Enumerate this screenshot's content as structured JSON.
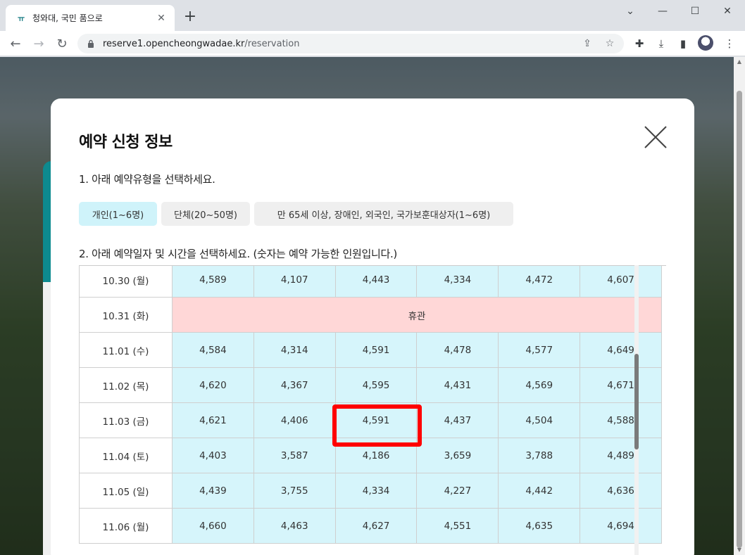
{
  "browser": {
    "tab_title": "청와대, 국민 품으로",
    "url_host": "reserve1.opencheongwadae.kr",
    "url_path": "/reservation",
    "favicon_text": "ㅠ"
  },
  "modal": {
    "title": "예약 신청 정보",
    "step1": "1. 아래 예약유형을 선택하세요.",
    "step2": "2. 아래 예약일자 및 시간을 선택하세요. (숫자는 예약 가능한 인원입니다.)",
    "types": [
      {
        "label": "개인(1~6명)",
        "selected": true
      },
      {
        "label": "단체(20~50명)",
        "selected": false
      },
      {
        "label": "만 65세 이상, 장애인, 외국인, 국가보훈대상자(1~6명)",
        "selected": false
      }
    ]
  },
  "schedule": {
    "closed_label": "휴관",
    "rows": [
      {
        "date": "10.30 (월)",
        "slots": [
          "4,589",
          "4,107",
          "4,443",
          "4,334",
          "4,472",
          "4,607"
        ]
      },
      {
        "date": "10.31 (화)",
        "closed": true
      },
      {
        "date": "11.01 (수)",
        "slots": [
          "4,584",
          "4,314",
          "4,591",
          "4,478",
          "4,577",
          "4,649"
        ]
      },
      {
        "date": "11.02 (목)",
        "slots": [
          "4,620",
          "4,367",
          "4,595",
          "4,431",
          "4,569",
          "4,671"
        ]
      },
      {
        "date": "11.03 (금)",
        "slots": [
          "4,621",
          "4,406",
          "4,591",
          "4,437",
          "4,504",
          "4,588"
        ]
      },
      {
        "date": "11.04 (토)",
        "slots": [
          "4,403",
          "3,587",
          "4,186",
          "3,659",
          "3,788",
          "4,489"
        ]
      },
      {
        "date": "11.05 (일)",
        "slots": [
          "4,439",
          "3,755",
          "4,334",
          "4,227",
          "4,442",
          "4,636"
        ]
      },
      {
        "date": "11.06 (월)",
        "slots": [
          "4,660",
          "4,463",
          "4,627",
          "4,551",
          "4,635",
          "4,694"
        ]
      }
    ]
  },
  "colors": {
    "available": "#d6f5fb",
    "closed": "#ffd7d7",
    "selected_type": "#cff3fa",
    "highlight": "#ff0000"
  }
}
